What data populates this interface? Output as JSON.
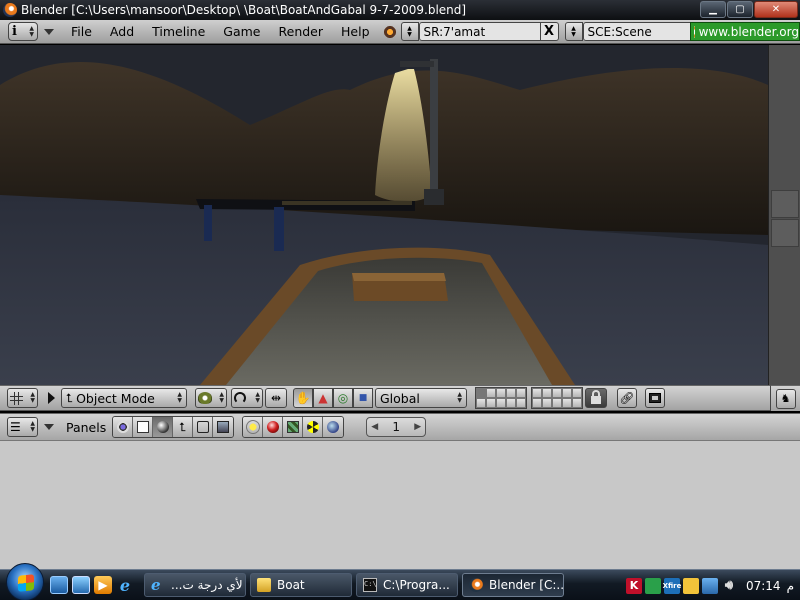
{
  "window": {
    "title": "Blender [C:\\Users\\mansoor\\Desktop\\  \\Boat\\BoatAndGabal 9-7-2009.blend]",
    "minimize": "▁",
    "maximize": "▢",
    "close": "✕"
  },
  "top_header": {
    "menus": [
      "File",
      "Add",
      "Timeline",
      "Game",
      "Render",
      "Help"
    ],
    "screen_field": "SR:7'amat",
    "scene_field": "SCE:Scene",
    "clear_glyph": "X",
    "url": "www.blender.org"
  },
  "view_header": {
    "mode": "Object Mode",
    "orientation": "Global"
  },
  "buttons_header": {
    "panels_label": "Panels",
    "frame": "1"
  },
  "taskbar": {
    "tasks": [
      {
        "label": "لأي درجة ت...",
        "icon": "ie-icon",
        "active": false
      },
      {
        "label": "Boat",
        "icon": "folder-icon",
        "active": false
      },
      {
        "label": "C:\\Progra...",
        "icon": "cmd-icon",
        "active": false
      },
      {
        "label": "Blender [C:...",
        "icon": "blender-icon",
        "active": true
      }
    ],
    "tray": {
      "kaspersky": "K",
      "xfire": "Xfire",
      "time": "07:14",
      "ampm": "م"
    }
  },
  "colors": {
    "header_gray": "#b8b8b8",
    "buttons_bg": "#c8c8c8",
    "url_green": "#2c9a2a",
    "blender_orange": "#ea7a1c"
  }
}
